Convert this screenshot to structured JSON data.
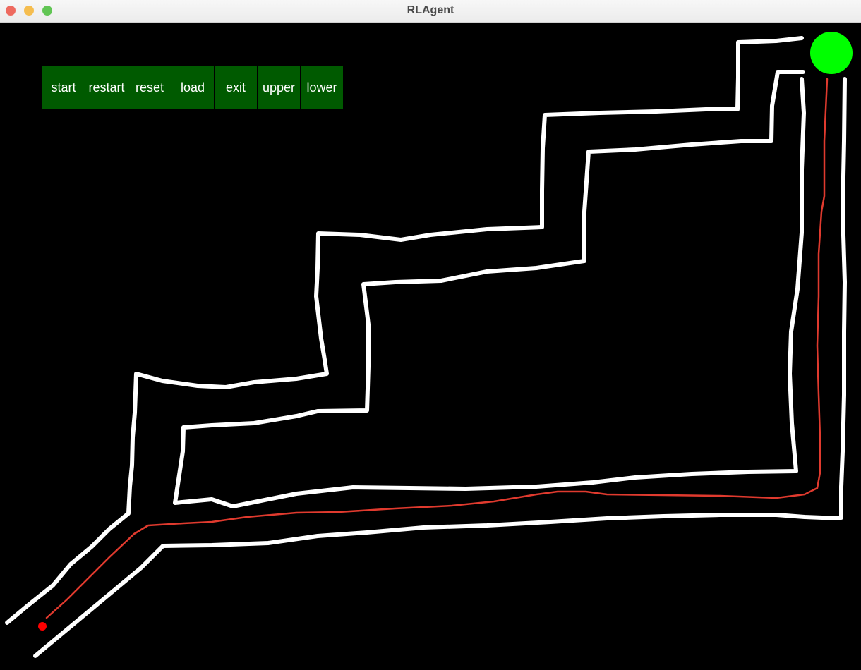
{
  "window": {
    "title": "RLAgent",
    "traffic_lights": [
      {
        "name": "close",
        "color": "#ee6a5f"
      },
      {
        "name": "minimize",
        "color": "#f5bd4f"
      },
      {
        "name": "zoom",
        "color": "#61c554"
      }
    ]
  },
  "toolbar": {
    "buttons": [
      {
        "id": "start",
        "label": "start"
      },
      {
        "id": "restart",
        "label": "restart"
      },
      {
        "id": "reset",
        "label": "reset"
      },
      {
        "id": "load",
        "label": "load"
      },
      {
        "id": "exit",
        "label": "exit"
      },
      {
        "id": "upper",
        "label": "upper"
      },
      {
        "id": "lower",
        "label": "lower"
      }
    ],
    "button_color": "#005a00",
    "label_color": "#ffffff"
  },
  "scene": {
    "background": "#000000",
    "track_color": "#ffffff",
    "path_color": "#e03a2e",
    "goal_color": "#00ff00",
    "agent_color": "#ff0000"
  }
}
